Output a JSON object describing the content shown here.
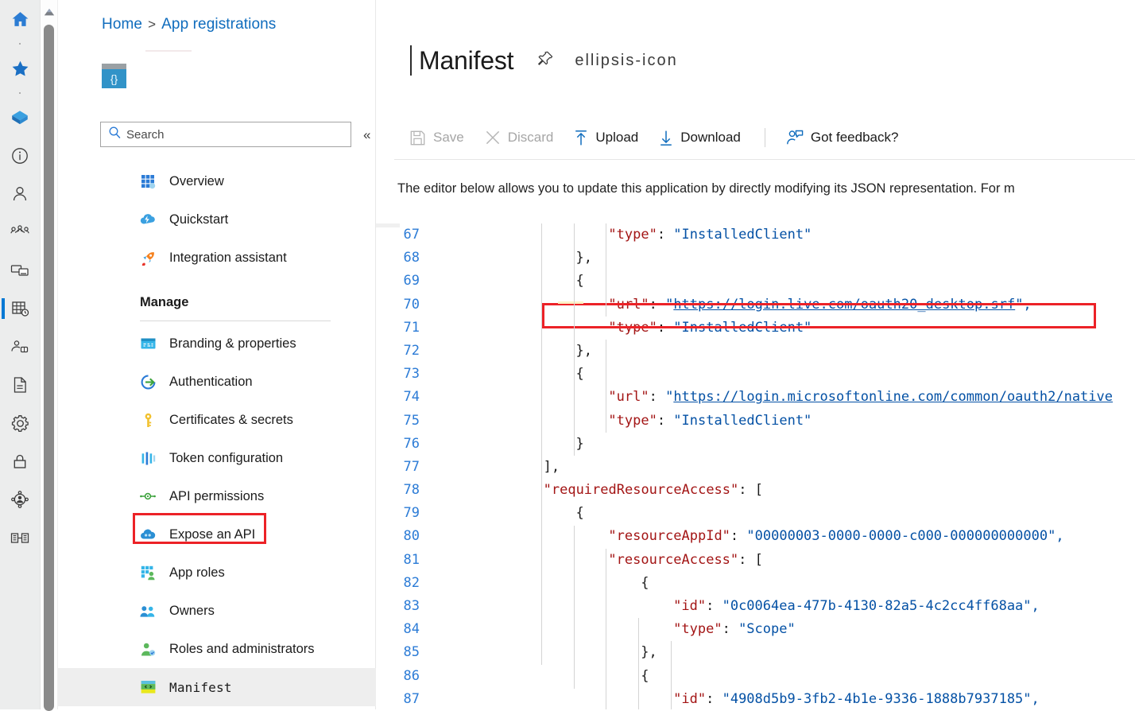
{
  "rail": {
    "items": [
      {
        "name": "home-icon",
        "label": "Home"
      },
      {
        "name": "favorites-star-icon",
        "label": "Favorites"
      },
      {
        "name": "azure-resource-icon",
        "label": "All resources"
      },
      {
        "name": "info-circle-icon",
        "label": "Help"
      },
      {
        "name": "user-icon",
        "label": "Users"
      },
      {
        "name": "groups-icon",
        "label": "Groups"
      },
      {
        "name": "devices-icon",
        "label": "Devices"
      },
      {
        "name": "app-registrations-icon",
        "label": "App registrations"
      },
      {
        "name": "enterprise-app-icon",
        "label": "Enterprise applications"
      },
      {
        "name": "document-icon",
        "label": "Documentation"
      },
      {
        "name": "gear-icon",
        "label": "Settings"
      },
      {
        "name": "lock-icon",
        "label": "Security"
      },
      {
        "name": "identity-governance-icon",
        "label": "Identity governance"
      },
      {
        "name": "tenant-icon",
        "label": "Tenant"
      }
    ]
  },
  "breadcrumb": {
    "home": "Home",
    "separator": ">",
    "current": "App registrations"
  },
  "app_icon": {
    "glyph": "{}"
  },
  "search": {
    "placeholder": "Search",
    "icon": "search-icon",
    "collapse_icon": "«"
  },
  "nav": {
    "items": [
      {
        "label": "Overview",
        "icon": "grid-overview-icon"
      },
      {
        "label": "Quickstart",
        "icon": "cloud-quickstart-icon"
      },
      {
        "label": "Integration assistant",
        "icon": "rocket-icon"
      }
    ],
    "group_header": "Manage",
    "manage_items": [
      {
        "label": "Branding & properties",
        "icon": "branding-icon"
      },
      {
        "label": "Authentication",
        "icon": "authentication-icon"
      },
      {
        "label": "Certificates & secrets",
        "icon": "key-icon"
      },
      {
        "label": "Token configuration",
        "icon": "token-icon"
      },
      {
        "label": "API permissions",
        "icon": "api-permissions-icon"
      },
      {
        "label": "Expose an API",
        "icon": "cloud-api-icon"
      },
      {
        "label": "App roles",
        "icon": "app-roles-icon"
      },
      {
        "label": "Owners",
        "icon": "owners-icon"
      },
      {
        "label": "Roles and administrators",
        "icon": "roles-admin-icon"
      },
      {
        "label": "Manifest",
        "icon": "manifest-icon",
        "active": true,
        "highlighted": true
      }
    ]
  },
  "page": {
    "title": "Manifest",
    "pin_icon": "pin-icon",
    "more_icon": "ellipsis-icon"
  },
  "toolbar": {
    "buttons": [
      {
        "label": "Save",
        "icon": "save-icon",
        "disabled": true
      },
      {
        "label": "Discard",
        "icon": "discard-x-icon",
        "disabled": true
      },
      {
        "label": "Upload",
        "icon": "upload-arrow-icon",
        "disabled": false
      },
      {
        "label": "Download",
        "icon": "download-arrow-icon",
        "disabled": false
      },
      {
        "label": "Got feedback?",
        "icon": "feedback-person-icon",
        "disabled": false,
        "after_separator": true
      }
    ]
  },
  "intro_text": "The editor below allows you to update this application by directly modifying its JSON representation. For m",
  "editor": {
    "first_line_number": 67,
    "highlight_color": "#ec2227",
    "highlighted_line": 80,
    "lines": [
      {
        "n": 67,
        "indent": 5,
        "tokens": [
          {
            "t": "\"type\"",
            "c": "k"
          },
          {
            "t": ": ",
            "c": "p"
          },
          {
            "t": "\"InstalledClient\"",
            "c": "s"
          }
        ]
      },
      {
        "n": 68,
        "indent": 4,
        "tokens": [
          {
            "t": "},",
            "c": "p"
          }
        ]
      },
      {
        "n": 69,
        "indent": 4,
        "tokens": [
          {
            "t": "{",
            "c": "p"
          }
        ]
      },
      {
        "n": 70,
        "indent": 5,
        "tokens": [
          {
            "t": "\"url\"",
            "c": "k"
          },
          {
            "t": ": ",
            "c": "p"
          },
          {
            "t": "\"",
            "c": "s"
          },
          {
            "t": "https://login.live.com/oauth20_desktop.srf",
            "c": "u"
          },
          {
            "t": "\",",
            "c": "s"
          }
        ]
      },
      {
        "n": 71,
        "indent": 5,
        "tokens": [
          {
            "t": "\"type\"",
            "c": "k"
          },
          {
            "t": ": ",
            "c": "p"
          },
          {
            "t": "\"InstalledClient\"",
            "c": "s"
          }
        ]
      },
      {
        "n": 72,
        "indent": 4,
        "tokens": [
          {
            "t": "},",
            "c": "p"
          }
        ]
      },
      {
        "n": 73,
        "indent": 4,
        "tokens": [
          {
            "t": "{",
            "c": "p"
          }
        ]
      },
      {
        "n": 74,
        "indent": 5,
        "tokens": [
          {
            "t": "\"url\"",
            "c": "k"
          },
          {
            "t": ": ",
            "c": "p"
          },
          {
            "t": "\"",
            "c": "s"
          },
          {
            "t": "https://login.microsoftonline.com/common/oauth2/native",
            "c": "u"
          }
        ]
      },
      {
        "n": 75,
        "indent": 5,
        "tokens": [
          {
            "t": "\"type\"",
            "c": "k"
          },
          {
            "t": ": ",
            "c": "p"
          },
          {
            "t": "\"InstalledClient\"",
            "c": "s"
          }
        ]
      },
      {
        "n": 76,
        "indent": 4,
        "tokens": [
          {
            "t": "}",
            "c": "p"
          }
        ]
      },
      {
        "n": 77,
        "indent": 3,
        "tokens": [
          {
            "t": "],",
            "c": "p"
          }
        ]
      },
      {
        "n": 78,
        "indent": 3,
        "tokens": [
          {
            "t": "\"requiredResourceAccess\"",
            "c": "k"
          },
          {
            "t": ": [",
            "c": "p"
          }
        ]
      },
      {
        "n": 79,
        "indent": 4,
        "tokens": [
          {
            "t": "{",
            "c": "p"
          }
        ]
      },
      {
        "n": 80,
        "indent": 5,
        "tokens": [
          {
            "t": "\"resourceAppId\"",
            "c": "k"
          },
          {
            "t": ": ",
            "c": "p"
          },
          {
            "t": "\"00000003-0000-0000-c000-000000000000\",",
            "c": "s"
          }
        ]
      },
      {
        "n": 81,
        "indent": 5,
        "tokens": [
          {
            "t": "\"resourceAccess\"",
            "c": "k"
          },
          {
            "t": ": [",
            "c": "p"
          }
        ]
      },
      {
        "n": 82,
        "indent": 6,
        "tokens": [
          {
            "t": "{",
            "c": "p"
          }
        ]
      },
      {
        "n": 83,
        "indent": 7,
        "tokens": [
          {
            "t": "\"id\"",
            "c": "k"
          },
          {
            "t": ": ",
            "c": "p"
          },
          {
            "t": "\"0c0064ea-477b-4130-82a5-4c2cc4ff68aa\",",
            "c": "s"
          }
        ]
      },
      {
        "n": 84,
        "indent": 7,
        "tokens": [
          {
            "t": "\"type\"",
            "c": "k"
          },
          {
            "t": ": ",
            "c": "p"
          },
          {
            "t": "\"Scope\"",
            "c": "s"
          }
        ]
      },
      {
        "n": 85,
        "indent": 6,
        "tokens": [
          {
            "t": "},",
            "c": "p"
          }
        ]
      },
      {
        "n": 86,
        "indent": 6,
        "tokens": [
          {
            "t": "{",
            "c": "p"
          }
        ]
      },
      {
        "n": 87,
        "indent": 7,
        "tokens": [
          {
            "t": "\"id\"",
            "c": "k"
          },
          {
            "t": ": ",
            "c": "p"
          },
          {
            "t": "\"4908d5b9-3fb2-4b1e-9336-1888b7937185\",",
            "c": "s"
          }
        ]
      }
    ]
  }
}
